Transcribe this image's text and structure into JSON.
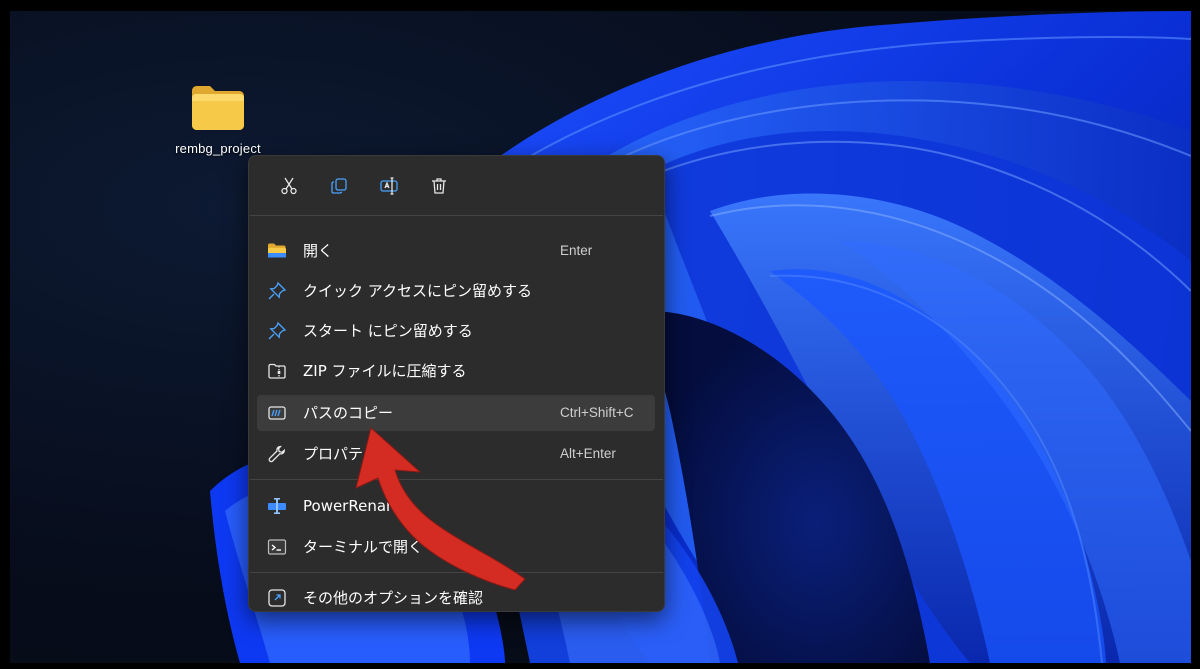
{
  "desktop": {
    "icon_label": "rembg_project",
    "icon_name": "folder-icon"
  },
  "context_menu": {
    "quick_actions": [
      {
        "name": "cut",
        "icon": "scissors-icon"
      },
      {
        "name": "copy",
        "icon": "copy-icon"
      },
      {
        "name": "rename",
        "icon": "rename-icon"
      },
      {
        "name": "delete",
        "icon": "trash-icon"
      }
    ],
    "items": [
      {
        "label": "開く",
        "shortcut": "Enter",
        "icon": "folder-open-icon"
      },
      {
        "label": "クイック アクセスにピン留めする",
        "shortcut": "",
        "icon": "pin-icon"
      },
      {
        "label": "スタート にピン留めする",
        "shortcut": "",
        "icon": "pin-icon"
      },
      {
        "label": "ZIP ファイルに圧縮する",
        "shortcut": "",
        "icon": "zip-icon"
      },
      {
        "label": "パスのコピー",
        "shortcut": "Ctrl+Shift+C",
        "icon": "copy-path-icon"
      },
      {
        "label": "プロパティ",
        "shortcut": "Alt+Enter",
        "icon": "wrench-icon"
      },
      {
        "label": "PowerRename",
        "shortcut": "",
        "icon": "power-rename-icon"
      },
      {
        "label": "ターミナルで開く",
        "shortcut": "",
        "icon": "terminal-icon"
      },
      {
        "label": "その他のオプションを確認",
        "shortcut": "",
        "icon": "more-options-icon"
      }
    ]
  },
  "colors": {
    "menu_background": "#2c2c2c",
    "menu_hover": "#3c3c3c",
    "accent_blue": "#4aa3ff",
    "arrow_red": "#d42b22",
    "folder_yellow": "#f7c948"
  }
}
